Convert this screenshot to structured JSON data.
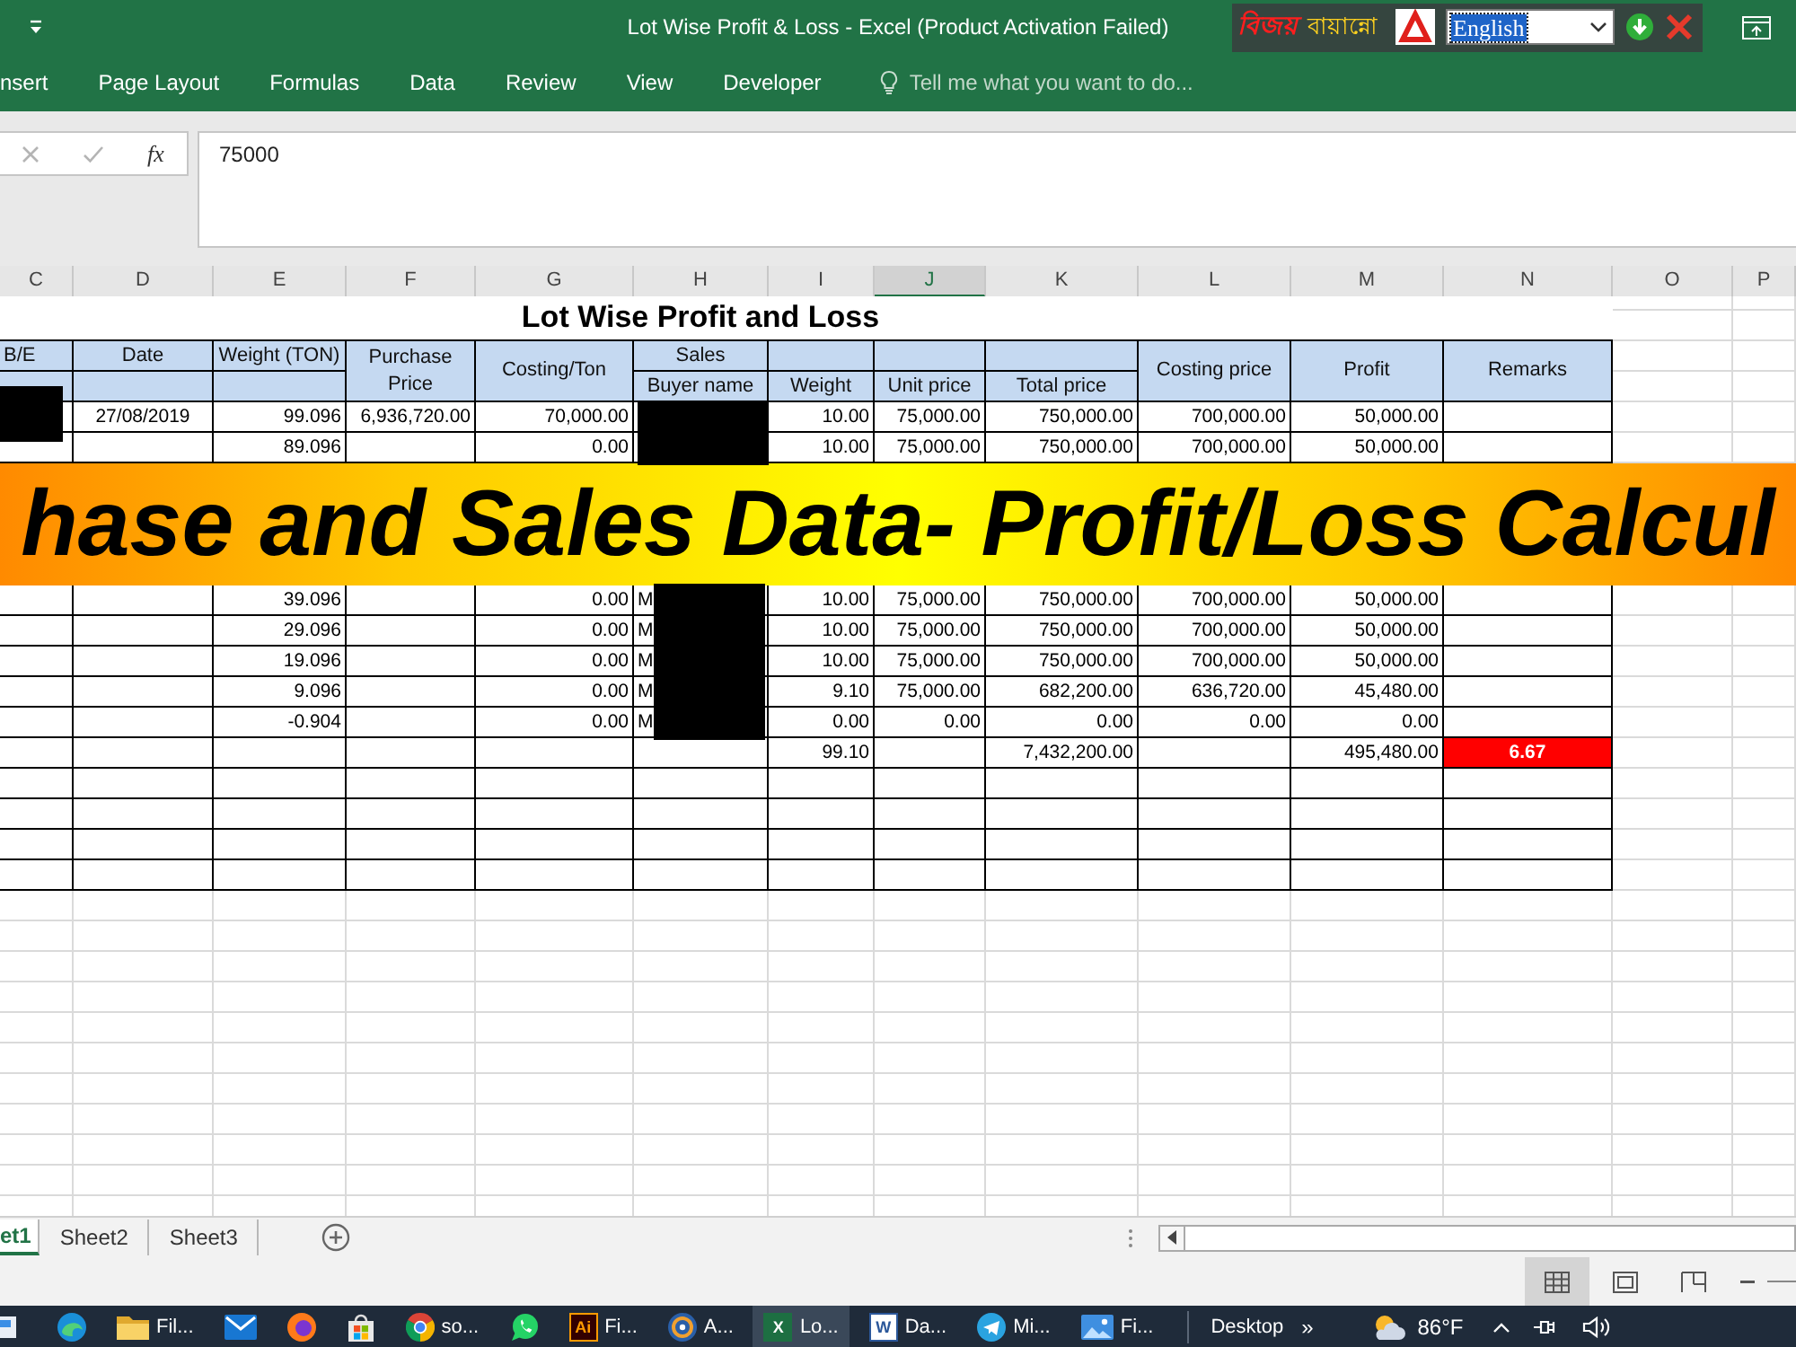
{
  "title_bar": {
    "title": "Lot Wise Profit & Loss - Excel (Product Activation Failed)",
    "keyboard_tool": {
      "logo_text": "বিজয়",
      "name": "বায়ান্নো",
      "language": "English",
      "highlighted": true
    }
  },
  "ribbon_tabs": [
    {
      "label": "nsert"
    },
    {
      "label": "Page Layout"
    },
    {
      "label": "Formulas"
    },
    {
      "label": "Data"
    },
    {
      "label": "Review"
    },
    {
      "label": "View"
    },
    {
      "label": "Developer"
    }
  ],
  "tell_me": {
    "placeholder": "Tell me what you want to do..."
  },
  "formula_bar": {
    "cancel": {
      "disabled": true
    },
    "enter": {
      "disabled": true
    },
    "function_label": "fx",
    "value": "75000"
  },
  "column_headers": [
    {
      "label": "C",
      "selected": false
    },
    {
      "label": "D",
      "selected": false
    },
    {
      "label": "E",
      "selected": false
    },
    {
      "label": "F",
      "selected": false
    },
    {
      "label": "G",
      "selected": false
    },
    {
      "label": "H",
      "selected": false
    },
    {
      "label": "I",
      "selected": false
    },
    {
      "label": "J",
      "selected": true
    },
    {
      "label": "K",
      "selected": false
    },
    {
      "label": "L",
      "selected": false
    },
    {
      "label": "M",
      "selected": false
    },
    {
      "label": "N",
      "selected": false
    },
    {
      "label": "O",
      "selected": false
    },
    {
      "label": "P",
      "selected": false
    }
  ],
  "sheet": {
    "title": "Lot Wise Profit and Loss",
    "columns": [
      {
        "label": "B/E",
        "kind": "top"
      },
      {
        "label": "Date",
        "kind": "top"
      },
      {
        "label": "Weight (TON)",
        "kind": "top"
      },
      {
        "label": "Purchase Price",
        "kind": "merged"
      },
      {
        "label": "Costing/Ton",
        "kind": "merged"
      },
      {
        "group": "Sales",
        "label": "Buyer name",
        "kind": "grouped"
      },
      {
        "label": "Weight",
        "kind": "bottom"
      },
      {
        "label": "Unit price",
        "kind": "bottom"
      },
      {
        "label": "Total price",
        "kind": "bottom"
      },
      {
        "label": "Costing price",
        "kind": "merged"
      },
      {
        "label": "Profit",
        "kind": "merged"
      },
      {
        "label": "Remarks",
        "kind": "merged"
      }
    ],
    "sections": [
      {
        "kind": "rows",
        "rows": [
          {
            "kind": "data",
            "be_redacted": true,
            "buyer_redacted": true,
            "date": "27/08/2019",
            "weight_ton": "99.096",
            "purchase_price": "6,936,720.00",
            "costing_per_ton": "70,000.00",
            "weight": "10.00",
            "unit_price": "75,000.00",
            "total_price": "750,000.00",
            "costing_price": "700,000.00",
            "profit": "50,000.00"
          },
          {
            "kind": "data",
            "be_redacted": false,
            "buyer_redacted": true,
            "weight_ton": "89.096",
            "costing_per_ton": "0.00",
            "weight": "10.00",
            "unit_price": "75,000.00",
            "total_price": "750,000.00",
            "costing_price": "700,000.00",
            "profit": "50,000.00"
          }
        ]
      },
      {
        "kind": "banner",
        "text": "hase and Sales Data- Profit/Loss Calcul"
      },
      {
        "kind": "rows",
        "rows": [
          {
            "kind": "data",
            "be_redacted": false,
            "buyer_redacted": true,
            "weight_ton": "39.096",
            "costing_per_ton": "0.00",
            "buyer_name": "M",
            "weight": "10.00",
            "unit_price": "75,000.00",
            "total_price": "750,000.00",
            "costing_price": "700,000.00",
            "profit": "50,000.00"
          },
          {
            "kind": "data",
            "be_redacted": false,
            "buyer_redacted": true,
            "weight_ton": "29.096",
            "costing_per_ton": "0.00",
            "buyer_name": "M",
            "weight": "10.00",
            "unit_price": "75,000.00",
            "total_price": "750,000.00",
            "costing_price": "700,000.00",
            "profit": "50,000.00"
          },
          {
            "kind": "data",
            "be_redacted": false,
            "buyer_redacted": true,
            "weight_ton": "19.096",
            "costing_per_ton": "0.00",
            "buyer_name": "M",
            "weight": "10.00",
            "unit_price": "75,000.00",
            "total_price": "750,000.00",
            "costing_price": "700,000.00",
            "profit": "50,000.00"
          },
          {
            "kind": "data",
            "be_redacted": false,
            "buyer_redacted": true,
            "weight_ton": "9.096",
            "costing_per_ton": "0.00",
            "buyer_name": "M",
            "weight": "9.10",
            "unit_price": "75,000.00",
            "total_price": "682,200.00",
            "costing_price": "636,720.00",
            "profit": "45,480.00"
          },
          {
            "kind": "data",
            "be_redacted": false,
            "buyer_redacted": true,
            "weight_ton": "-0.904",
            "costing_per_ton": "0.00",
            "buyer_name": "M",
            "weight": "0.00",
            "unit_price": "0.00",
            "total_price": "0.00",
            "costing_price": "0.00",
            "profit": "0.00"
          },
          {
            "kind": "total",
            "be_redacted": false,
            "buyer_redacted": false,
            "weight": "99.10",
            "total_price": "7,432,200.00",
            "profit": "495,480.00",
            "remarks": "6.67"
          },
          {
            "kind": "data",
            "be_redacted": false,
            "buyer_redacted": false
          },
          {
            "kind": "data",
            "be_redacted": false,
            "buyer_redacted": false
          },
          {
            "kind": "data",
            "be_redacted": false,
            "buyer_redacted": false
          },
          {
            "kind": "data",
            "be_redacted": false,
            "buyer_redacted": false
          }
        ]
      }
    ]
  },
  "sheet_tabs": [
    {
      "label": "et1",
      "selected": true
    },
    {
      "label": "Sheet2",
      "selected": false
    },
    {
      "label": "Sheet3",
      "selected": false
    }
  ],
  "status_bar": {
    "views": [
      {
        "kind": "normal",
        "selected": true
      },
      {
        "kind": "page_layout",
        "selected": false
      },
      {
        "kind": "page_break",
        "selected": false
      }
    ]
  },
  "taskbar": {
    "items": [
      {
        "kind": "window",
        "selected": false
      },
      {
        "kind": "swirl",
        "selected": false
      },
      {
        "kind": "folder",
        "label": "Fil...",
        "selected": false
      },
      {
        "kind": "mail",
        "selected": false
      },
      {
        "kind": "ring",
        "selected": false
      },
      {
        "kind": "store",
        "selected": false
      },
      {
        "kind": "wheel",
        "label": "so...",
        "selected": false
      },
      {
        "kind": "chat",
        "selected": false
      },
      {
        "kind": "ai_tile",
        "logo": "Ai",
        "label": "Fi...",
        "selected": false
      },
      {
        "kind": "disc",
        "label": "A...",
        "selected": false
      },
      {
        "kind": "sheet_tile",
        "logo": "X",
        "label": "Lo...",
        "selected": true
      },
      {
        "kind": "doc_tile",
        "logo": "W",
        "label": "Da...",
        "selected": false
      },
      {
        "kind": "plane",
        "label": "Mi...",
        "selected": false
      },
      {
        "kind": "photo",
        "label": "Fi...",
        "selected": false
      }
    ],
    "toolbar": "Desktop",
    "overflow": "»",
    "temperature": "86°F"
  }
}
